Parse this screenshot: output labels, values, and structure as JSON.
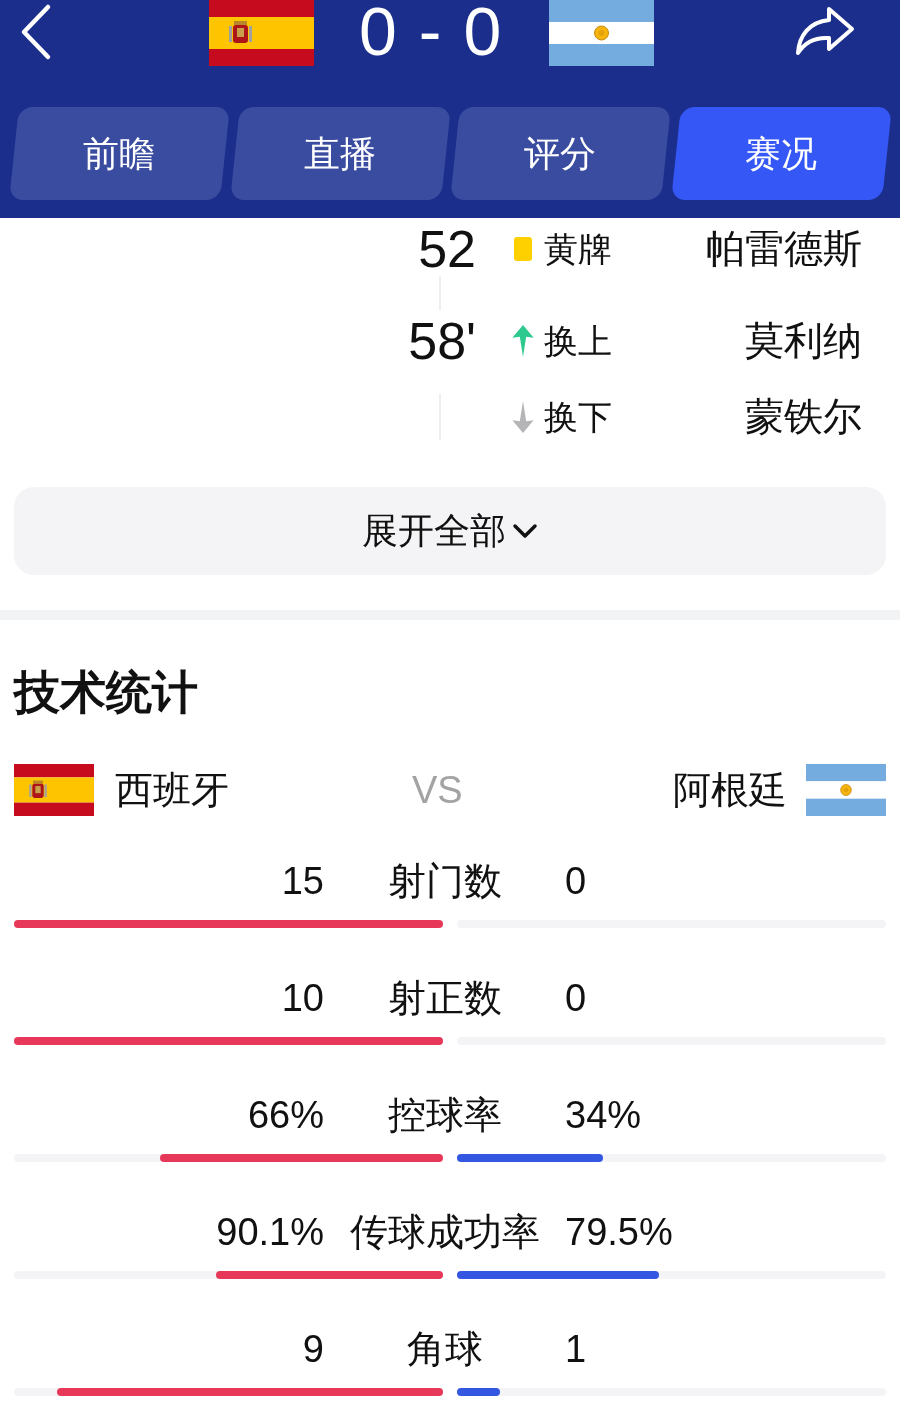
{
  "header": {
    "score": {
      "home": "0",
      "separator": "-",
      "away": "0"
    }
  },
  "tabs": [
    {
      "label": "前瞻",
      "selected": false
    },
    {
      "label": "直播",
      "selected": false
    },
    {
      "label": "评分",
      "selected": false
    },
    {
      "label": "赛况",
      "selected": true
    }
  ],
  "events": [
    {
      "minute": "52",
      "items": [
        {
          "kind": "yellow_card",
          "label": "黄牌",
          "player": "帕雷德斯"
        }
      ]
    },
    {
      "minute": "58'",
      "items": [
        {
          "kind": "sub_in",
          "label": "换上",
          "player": "莫利纳"
        },
        {
          "kind": "sub_out",
          "label": "换下",
          "player": "蒙铁尔"
        }
      ]
    }
  ],
  "expand_button": {
    "label": "展开全部"
  },
  "stats": {
    "title": "技术统计",
    "home_team": "西班牙",
    "vs": "VS",
    "away_team": "阿根廷",
    "rows": [
      {
        "label": "射门数",
        "home": "15",
        "away": "0",
        "home_bar": {
          "level": 1
        },
        "away_bar": {
          "level": 0
        }
      },
      {
        "label": "射正数",
        "home": "10",
        "away": "0",
        "home_bar": {
          "level": 1
        },
        "away_bar": {
          "level": 0
        }
      },
      {
        "label": "控球率",
        "home": "66%",
        "away": "34%",
        "home_bar": {
          "level": 0.66
        },
        "away_bar": {
          "level": 0.34
        }
      },
      {
        "label": "传球成功率",
        "home": "90.1%",
        "away": "79.5%",
        "home_bar": {
          "level": 0.53
        },
        "away_bar": {
          "level": 0.47
        }
      },
      {
        "label": "角球",
        "home": "9",
        "away": "1",
        "home_bar": {
          "level": 0.9
        },
        "away_bar": {
          "level": 0.1
        }
      }
    ]
  }
}
